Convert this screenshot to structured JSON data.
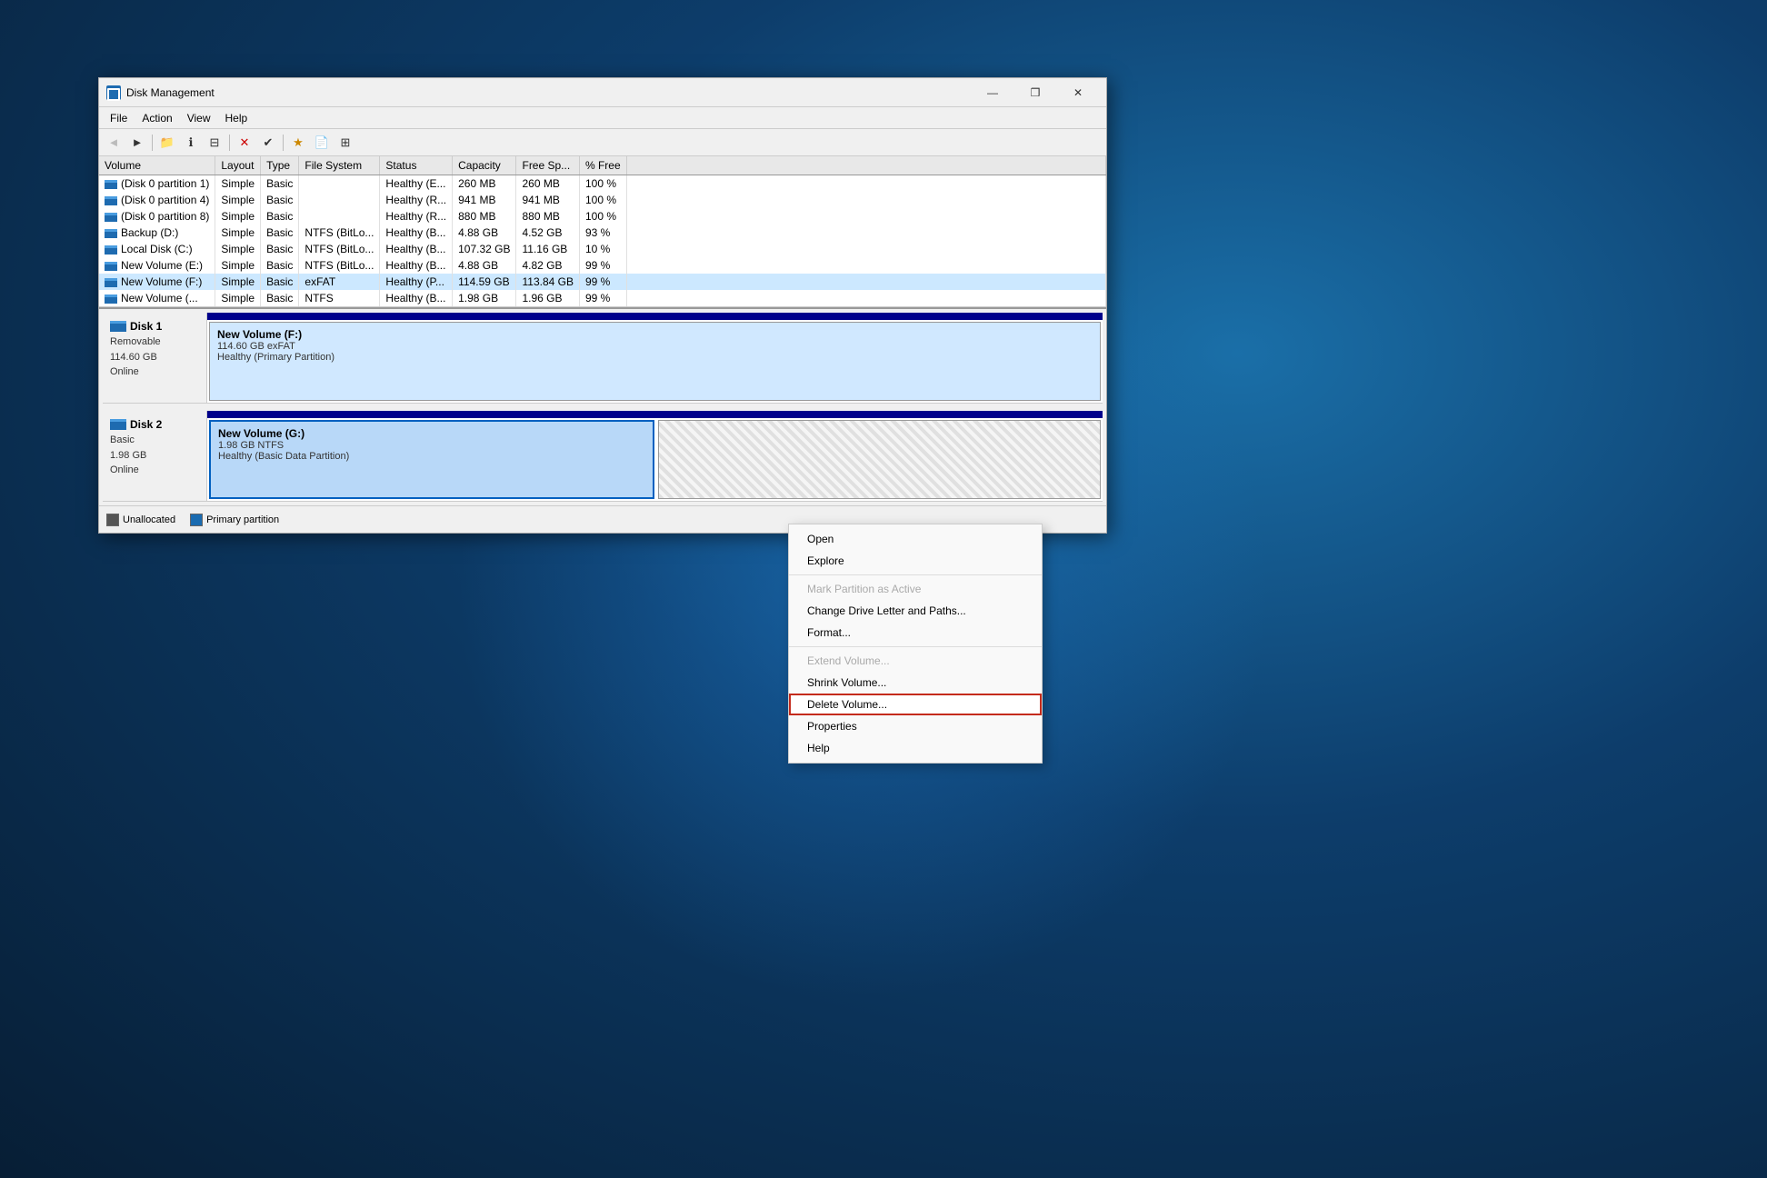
{
  "window": {
    "title": "Disk Management",
    "min_btn": "—",
    "max_btn": "❒",
    "close_btn": "✕"
  },
  "menu": {
    "items": [
      "File",
      "Action",
      "View",
      "Help"
    ]
  },
  "toolbar": {
    "buttons": [
      "←",
      "→",
      "📁",
      "ℹ",
      "⊟",
      "✕",
      "✔",
      "★",
      "🖹",
      "⊞"
    ]
  },
  "table": {
    "headers": [
      "Volume",
      "Layout",
      "Type",
      "File System",
      "Status",
      "Capacity",
      "Free Sp...",
      "% Free"
    ],
    "rows": [
      {
        "volume": "(Disk 0 partition 1)",
        "layout": "Simple",
        "type": "Basic",
        "fs": "",
        "status": "Healthy (E...",
        "capacity": "260 MB",
        "free": "260 MB",
        "pct": "100 %"
      },
      {
        "volume": "(Disk 0 partition 4)",
        "layout": "Simple",
        "type": "Basic",
        "fs": "",
        "status": "Healthy (R...",
        "capacity": "941 MB",
        "free": "941 MB",
        "pct": "100 %"
      },
      {
        "volume": "(Disk 0 partition 8)",
        "layout": "Simple",
        "type": "Basic",
        "fs": "",
        "status": "Healthy (R...",
        "capacity": "880 MB",
        "free": "880 MB",
        "pct": "100 %"
      },
      {
        "volume": "Backup (D:)",
        "layout": "Simple",
        "type": "Basic",
        "fs": "NTFS (BitLo...",
        "status": "Healthy (B...",
        "capacity": "4.88 GB",
        "free": "4.52 GB",
        "pct": "93 %"
      },
      {
        "volume": "Local Disk (C:)",
        "layout": "Simple",
        "type": "Basic",
        "fs": "NTFS (BitLo...",
        "status": "Healthy (B...",
        "capacity": "107.32 GB",
        "free": "11.16 GB",
        "pct": "10 %"
      },
      {
        "volume": "New Volume (E:)",
        "layout": "Simple",
        "type": "Basic",
        "fs": "NTFS (BitLo...",
        "status": "Healthy (B...",
        "capacity": "4.88 GB",
        "free": "4.82 GB",
        "pct": "99 %"
      },
      {
        "volume": "New Volume (F:)",
        "layout": "Simple",
        "type": "Basic",
        "fs": "exFAT",
        "status": "Healthy (P...",
        "capacity": "114.59 GB",
        "free": "113.84 GB",
        "pct": "99 %"
      },
      {
        "volume": "New Volume (...",
        "layout": "Simple",
        "type": "Basic",
        "fs": "NTFS",
        "status": "Healthy (B...",
        "capacity": "1.98 GB",
        "free": "1.96 GB",
        "pct": "99 %"
      }
    ]
  },
  "disks": {
    "disk1": {
      "name": "Disk 1",
      "type": "Removable",
      "size": "114.60 GB",
      "status": "Online",
      "partition": {
        "name": "New Volume  (F:)",
        "size": "114.60 GB exFAT",
        "status": "Healthy (Primary Partition)"
      }
    },
    "disk2": {
      "name": "Disk 2",
      "type": "Basic",
      "size": "1.98 GB",
      "status": "Online",
      "partition": {
        "name": "New Volume  (G:)",
        "size": "1.98 GB NTFS",
        "status": "Healthy (Basic Data Partition)"
      }
    }
  },
  "legend": {
    "items": [
      {
        "label": "Unallocated",
        "color": "#555"
      },
      {
        "label": "Primary partition",
        "color": "#1a6bb0"
      }
    ]
  },
  "context_menu": {
    "items": [
      {
        "label": "Open",
        "disabled": false,
        "separator_after": false
      },
      {
        "label": "Explore",
        "disabled": false,
        "separator_after": true
      },
      {
        "label": "Mark Partition as Active",
        "disabled": true,
        "separator_after": false
      },
      {
        "label": "Change Drive Letter and Paths...",
        "disabled": false,
        "separator_after": false
      },
      {
        "label": "Format...",
        "disabled": false,
        "separator_after": true
      },
      {
        "label": "Extend Volume...",
        "disabled": true,
        "separator_after": false
      },
      {
        "label": "Shrink Volume...",
        "disabled": false,
        "separator_after": false
      },
      {
        "label": "Delete Volume...",
        "disabled": false,
        "highlighted": true,
        "separator_after": false
      },
      {
        "label": "Properties",
        "disabled": false,
        "separator_after": false
      },
      {
        "label": "Help",
        "disabled": false,
        "separator_after": false
      }
    ]
  }
}
